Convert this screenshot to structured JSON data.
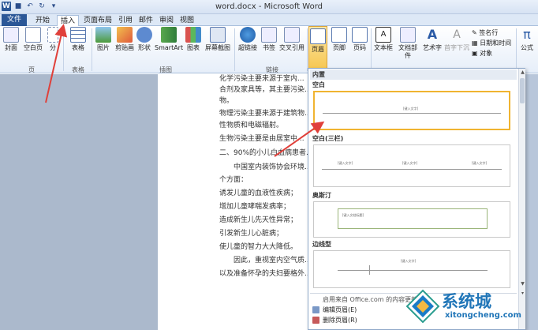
{
  "window": {
    "title": "word.docx - Microsoft Word"
  },
  "tabs": [
    {
      "label": "文件"
    },
    {
      "label": "开始"
    },
    {
      "label": "插入"
    },
    {
      "label": "页面布局"
    },
    {
      "label": "引用"
    },
    {
      "label": "邮件"
    },
    {
      "label": "审阅"
    },
    {
      "label": "视图"
    }
  ],
  "ribbon": {
    "pages_group": {
      "cover": "封面",
      "blank": "空白页",
      "break": "分",
      "label": "页"
    },
    "table_group": {
      "table": "表格",
      "label": "表格"
    },
    "illus_group": {
      "picture": "图片",
      "clipart": "剪贴画",
      "shapes": "形状",
      "smartart": "SmartArt",
      "chart": "图表",
      "screenshot": "屏幕截图",
      "label": "插图"
    },
    "links_group": {
      "hyperlink": "超链接",
      "bookmark": "书签",
      "crossref": "交叉引用",
      "label": "链接"
    },
    "header_group": {
      "header": "页眉",
      "footer": "页脚",
      "pagenum": "页码"
    },
    "text_group": {
      "textbox": "文本框",
      "docparts": "文档部件",
      "wordart": "艺术字",
      "dropcap": "首字下沉",
      "signature": "签名行",
      "datetime": "日期和时间",
      "object": "对象"
    },
    "symbols_group": {
      "equation": "公式"
    }
  },
  "document": {
    "lines": [
      "化学污染主要来源于室内...",
      "合剂及家具等，其主要污染...",
      "物。",
      "物理污染主要来源于建筑物...",
      "性物质和电磁辐射。",
      "生物污染主要是由居室中...",
      "二、90%的小儿白血病患者...",
      "中国室内装饰协会环境...",
      "个方面：",
      "诱发儿童的血液性疾病；",
      "增加儿童哮喘发病率；",
      "造成新生儿先天性异常；",
      "引发新生儿心脏病；",
      "使儿童的智力大大降低。",
      "因此，重视室内空气质...",
      "以及准备怀孕的夫妇要格外..."
    ]
  },
  "gallery": {
    "section_header": "内置",
    "items": [
      {
        "name": "空白",
        "placeholder": "[键入文字]"
      },
      {
        "name": "空白(三栏)",
        "placeholder": "[键入文字]"
      },
      {
        "name": "奥斯汀",
        "placeholder": "[键入文档标题]"
      },
      {
        "name": "边线型",
        "placeholder": "[键入文字]"
      }
    ],
    "menu": [
      {
        "label": "启用来自 Office.com 的内容更新(O)..."
      },
      {
        "label": "编辑页眉(E)"
      },
      {
        "label": "删除页眉(R)"
      }
    ]
  },
  "watermark": {
    "text": "系统城",
    "url": "xitongcheng.com"
  },
  "colors": {
    "file_tab": "#2b5797",
    "selected_border": "#f0b431",
    "arrow": "#e0403a",
    "brand": "#2176b8"
  }
}
